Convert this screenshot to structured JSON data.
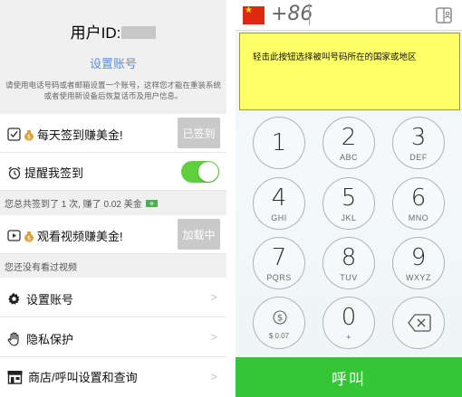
{
  "left": {
    "user_id_label": "用户ID:",
    "setup_account_link": "设置账号",
    "hint": "请使用电话号码或者邮箱设置一个账号，这样您才能在重装系统或者使用新设备后恢复话币及用户信息。",
    "daily_checkin": {
      "label": "每天签到赚美金!",
      "button": "已签到"
    },
    "remind_checkin": {
      "label": "提醒我签到",
      "enabled": true
    },
    "checkin_summary": "您总共签到了 1 次, 赚了 0.02 美金",
    "watch_video": {
      "label": "观看视频赚美金!",
      "button": "加载中"
    },
    "video_summary": "您还没有看过视频",
    "menu": [
      {
        "label": "设置账号",
        "icon": "gear-icon"
      },
      {
        "label": "隐私保护",
        "icon": "hand-icon"
      },
      {
        "label": "商店/呼叫设置和查询",
        "icon": "store-icon"
      }
    ],
    "chevron": ">"
  },
  "right": {
    "country_code": "+86",
    "tooltip": "轻击此按钮选择被叫号码所在的国家或地区",
    "keys": [
      {
        "digit": "1",
        "letters": ""
      },
      {
        "digit": "2",
        "letters": "ABC"
      },
      {
        "digit": "3",
        "letters": "DEF"
      },
      {
        "digit": "4",
        "letters": "GHI"
      },
      {
        "digit": "5",
        "letters": "JKL"
      },
      {
        "digit": "6",
        "letters": "MNO"
      },
      {
        "digit": "7",
        "letters": "PQRS"
      },
      {
        "digit": "8",
        "letters": "TUV"
      },
      {
        "digit": "9",
        "letters": "WXYZ"
      },
      {
        "digit": "0",
        "letters": "+"
      }
    ],
    "credit": "$ 0.07",
    "call_button": "呼叫"
  },
  "colors": {
    "accent_link": "#5b8fd9",
    "toggle_on": "#5fcf3c",
    "call_green": "#34c634",
    "tooltip_yellow": "#ffff66",
    "flag_red": "#de2910"
  }
}
